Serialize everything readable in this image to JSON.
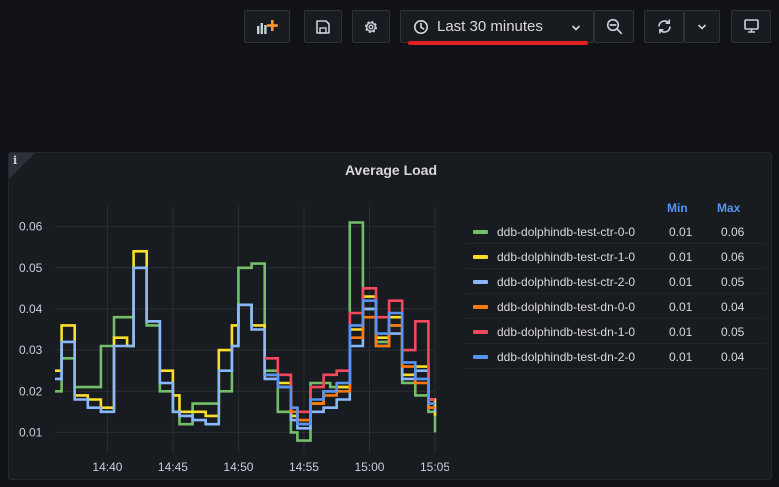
{
  "toolbar": {
    "add_panel_icon": "add-panel-icon",
    "save_icon": "save-icon",
    "settings_icon": "gear-icon",
    "time_range_label": "Last 30 minutes",
    "zoom_out_icon": "zoom-out-icon",
    "refresh_icon": "refresh-icon",
    "refresh_interval_icon": "chevron-down-icon",
    "view_mode_icon": "monitor-icon",
    "accent_underline": "#e02020"
  },
  "panel": {
    "info_icon_text": "i",
    "title": "Average Load",
    "legend": {
      "min_header": "Min",
      "max_header": "Max",
      "items": [
        {
          "name": "ddb-dolphindb-test-ctr-0-0",
          "min": "0.01",
          "max": "0.06",
          "color": "#73bf69"
        },
        {
          "name": "ddb-dolphindb-test-ctr-1-0",
          "min": "0.01",
          "max": "0.06",
          "color": "#fade2a"
        },
        {
          "name": "ddb-dolphindb-test-ctr-2-0",
          "min": "0.01",
          "max": "0.05",
          "color": "#8ab8ff"
        },
        {
          "name": "ddb-dolphindb-test-dn-0-0",
          "min": "0.01",
          "max": "0.04",
          "color": "#ff780a"
        },
        {
          "name": "ddb-dolphindb-test-dn-1-0",
          "min": "0.01",
          "max": "0.05",
          "color": "#f2495c"
        },
        {
          "name": "ddb-dolphindb-test-dn-2-0",
          "min": "0.01",
          "max": "0.04",
          "color": "#5794f2"
        }
      ]
    }
  },
  "chart_data": {
    "type": "line",
    "title": "Average Load",
    "xlabel": "",
    "ylabel": "",
    "x_ticks": [
      "14:40",
      "14:45",
      "14:50",
      "14:55",
      "15:00",
      "15:05"
    ],
    "y_ticks": [
      "0.01",
      "0.02",
      "0.03",
      "0.04",
      "0.05",
      "0.06"
    ],
    "xlim": [
      "14:36:00",
      "15:05:00"
    ],
    "ylim": [
      0.005,
      0.065
    ],
    "grid": true,
    "legend_placement": "right",
    "x": [
      "14:36:00",
      "14:36:30",
      "14:37:00",
      "14:37:30",
      "14:38:00",
      "14:38:30",
      "14:39:00",
      "14:39:30",
      "14:40:00",
      "14:40:30",
      "14:41:00",
      "14:41:30",
      "14:42:00",
      "14:42:30",
      "14:43:00",
      "14:43:30",
      "14:44:00",
      "14:44:30",
      "14:45:00",
      "14:45:30",
      "14:46:00",
      "14:46:30",
      "14:47:00",
      "14:47:30",
      "14:48:00",
      "14:48:30",
      "14:49:00",
      "14:49:30",
      "14:50:00",
      "14:50:30",
      "14:51:00",
      "14:51:30",
      "14:52:00",
      "14:52:30",
      "14:53:00",
      "14:53:30",
      "14:54:00",
      "14:54:30",
      "14:55:00",
      "14:55:30",
      "14:56:00",
      "14:56:30",
      "14:57:00",
      "14:57:30",
      "14:58:00",
      "14:58:30",
      "14:59:00",
      "14:59:30",
      "15:00:00",
      "15:00:30",
      "15:01:00",
      "15:01:30",
      "15:02:00",
      "15:02:30",
      "15:03:00",
      "15:03:30",
      "15:04:00",
      "15:04:30",
      "15:05:00"
    ],
    "series": [
      {
        "name": "ddb-dolphindb-test-ctr-0-0",
        "color": "#73bf69",
        "values": [
          0.02,
          0.028,
          0.028,
          0.021,
          0.021,
          0.021,
          0.021,
          0.031,
          0.031,
          0.038,
          0.038,
          0.038,
          0.05,
          0.05,
          0.036,
          0.036,
          0.02,
          0.02,
          0.015,
          0.012,
          0.012,
          0.017,
          0.017,
          0.017,
          0.017,
          0.02,
          0.02,
          0.031,
          0.05,
          0.05,
          0.051,
          0.051,
          0.025,
          0.025,
          0.015,
          0.015,
          0.01,
          0.008,
          0.008,
          0.022,
          0.022,
          0.022,
          0.021,
          0.021,
          0.021,
          0.061,
          0.061,
          0.04,
          0.04,
          0.032,
          0.032,
          0.036,
          0.036,
          0.022,
          0.022,
          0.019,
          0.019,
          0.015,
          0.01
        ]
      },
      {
        "name": "ddb-dolphindb-test-ctr-1-0",
        "color": "#fade2a",
        "values": [
          0.025,
          0.036,
          0.036,
          0.019,
          0.019,
          0.018,
          0.018,
          0.016,
          0.016,
          0.033,
          0.033,
          0.031,
          0.054,
          0.054,
          0.037,
          0.037,
          0.025,
          0.025,
          0.019,
          0.015,
          0.015,
          0.015,
          0.015,
          0.014,
          0.014,
          0.03,
          0.03,
          0.036,
          0.041,
          0.041,
          0.036,
          0.036,
          0.024,
          0.024,
          0.022,
          0.022,
          0.014,
          0.012,
          0.012,
          0.017,
          0.017,
          0.02,
          0.02,
          0.021,
          0.021,
          0.035,
          0.035,
          0.043,
          0.043,
          0.033,
          0.033,
          0.038,
          0.038,
          0.024,
          0.024,
          0.026,
          0.026,
          0.018,
          0.014
        ]
      },
      {
        "name": "ddb-dolphindb-test-ctr-2-0",
        "color": "#8ab8ff",
        "values": [
          0.023,
          0.032,
          0.032,
          0.018,
          0.018,
          0.016,
          0.016,
          0.015,
          0.015,
          0.031,
          0.031,
          0.031,
          0.05,
          0.05,
          0.037,
          0.037,
          0.022,
          0.022,
          0.015,
          0.014,
          0.014,
          0.013,
          0.013,
          0.012,
          0.012,
          0.025,
          0.025,
          0.031,
          0.041,
          0.041,
          0.035,
          0.035,
          0.023,
          0.023,
          0.021,
          0.021,
          0.013,
          0.011,
          0.011,
          0.015,
          0.015,
          0.016,
          0.016,
          0.018,
          0.018,
          0.031,
          0.031,
          0.04,
          0.04,
          0.031,
          0.031,
          0.034,
          0.034,
          0.023,
          0.023,
          0.025,
          0.025,
          0.016,
          0.015
        ]
      },
      {
        "name": "ddb-dolphindb-test-dn-0-0",
        "color": "#ff780a",
        "values": [
          null,
          null,
          null,
          null,
          null,
          null,
          null,
          null,
          null,
          null,
          null,
          null,
          null,
          null,
          null,
          null,
          null,
          null,
          null,
          null,
          null,
          null,
          null,
          null,
          null,
          null,
          null,
          null,
          null,
          null,
          null,
          null,
          0.024,
          0.024,
          0.021,
          0.021,
          0.015,
          0.013,
          0.013,
          0.017,
          0.017,
          0.019,
          0.019,
          0.02,
          0.02,
          0.033,
          0.033,
          0.038,
          0.038,
          0.031,
          0.031,
          0.036,
          0.036,
          0.026,
          0.026,
          0.022,
          0.022,
          0.016,
          0.016
        ]
      },
      {
        "name": "ddb-dolphindb-test-dn-1-0",
        "color": "#f2495c",
        "values": [
          null,
          null,
          null,
          null,
          null,
          null,
          null,
          null,
          null,
          null,
          null,
          null,
          null,
          null,
          null,
          null,
          null,
          null,
          null,
          null,
          null,
          null,
          null,
          null,
          null,
          null,
          null,
          null,
          null,
          null,
          null,
          null,
          0.028,
          0.028,
          0.024,
          0.024,
          0.016,
          0.015,
          0.015,
          0.021,
          0.021,
          0.024,
          0.024,
          0.025,
          0.025,
          0.039,
          0.039,
          0.045,
          0.045,
          0.038,
          0.038,
          0.042,
          0.042,
          0.03,
          0.03,
          0.037,
          0.037,
          0.018,
          0.018
        ]
      },
      {
        "name": "ddb-dolphindb-test-dn-2-0",
        "color": "#5794f2",
        "values": [
          null,
          null,
          null,
          null,
          null,
          null,
          null,
          null,
          null,
          null,
          null,
          null,
          null,
          null,
          null,
          null,
          null,
          null,
          null,
          null,
          null,
          null,
          null,
          null,
          null,
          null,
          null,
          null,
          null,
          null,
          null,
          null,
          0.024,
          0.024,
          0.021,
          0.021,
          0.016,
          0.012,
          0.012,
          0.018,
          0.018,
          0.02,
          0.02,
          0.022,
          0.022,
          0.036,
          0.036,
          0.042,
          0.042,
          0.034,
          0.034,
          0.039,
          0.039,
          0.027,
          0.027,
          0.023,
          0.023,
          0.017,
          0.017
        ]
      }
    ]
  }
}
